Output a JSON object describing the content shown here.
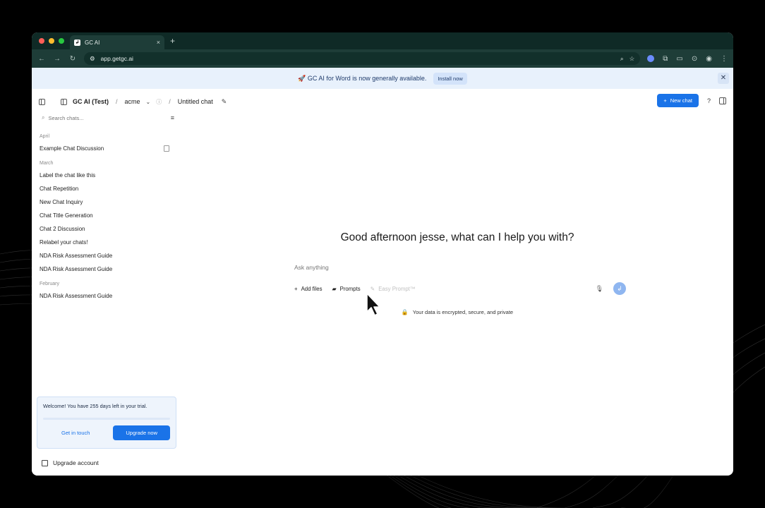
{
  "browser": {
    "tab_title": "GC AI",
    "tab_close": "×",
    "new_tab": "+",
    "url": "app.getgc.ai"
  },
  "banner": {
    "text": "🚀 GC AI for Word is now generally available.",
    "button": "Install now",
    "close": "✕"
  },
  "header": {
    "workspace": "GC AI (Test)",
    "org": "acme",
    "chat_title": "Untitled chat",
    "new_chat": "New chat",
    "help": "?"
  },
  "sidebar": {
    "search_placeholder": "Search chats...",
    "groups": [
      {
        "label": "April",
        "items": [
          "Example Chat Discussion"
        ]
      },
      {
        "label": "March",
        "items": [
          "Label the chat like this",
          "Chat Repetition",
          "New Chat Inquiry",
          "Chat Title Generation",
          "Chat 2 Discussion",
          "Relabel your chats!",
          "NDA Risk Assessment Guide",
          "NDA Risk Assessment Guide"
        ]
      },
      {
        "label": "February",
        "items": [
          "NDA Risk Assessment Guide"
        ]
      }
    ],
    "trial": {
      "text": "Welcome! You have 255 days left in your trial.",
      "get_in_touch": "Get in touch",
      "upgrade_now": "Upgrade now"
    },
    "upgrade_account": "Upgrade account"
  },
  "main": {
    "greeting": "Good afternoon jesse, what can I help you with?",
    "ask_placeholder": "Ask anything",
    "add_files": "Add files",
    "prompts": "Prompts",
    "easy_prompt": "Easy Prompt™",
    "privacy": "Your data is encrypted, secure, and private"
  }
}
